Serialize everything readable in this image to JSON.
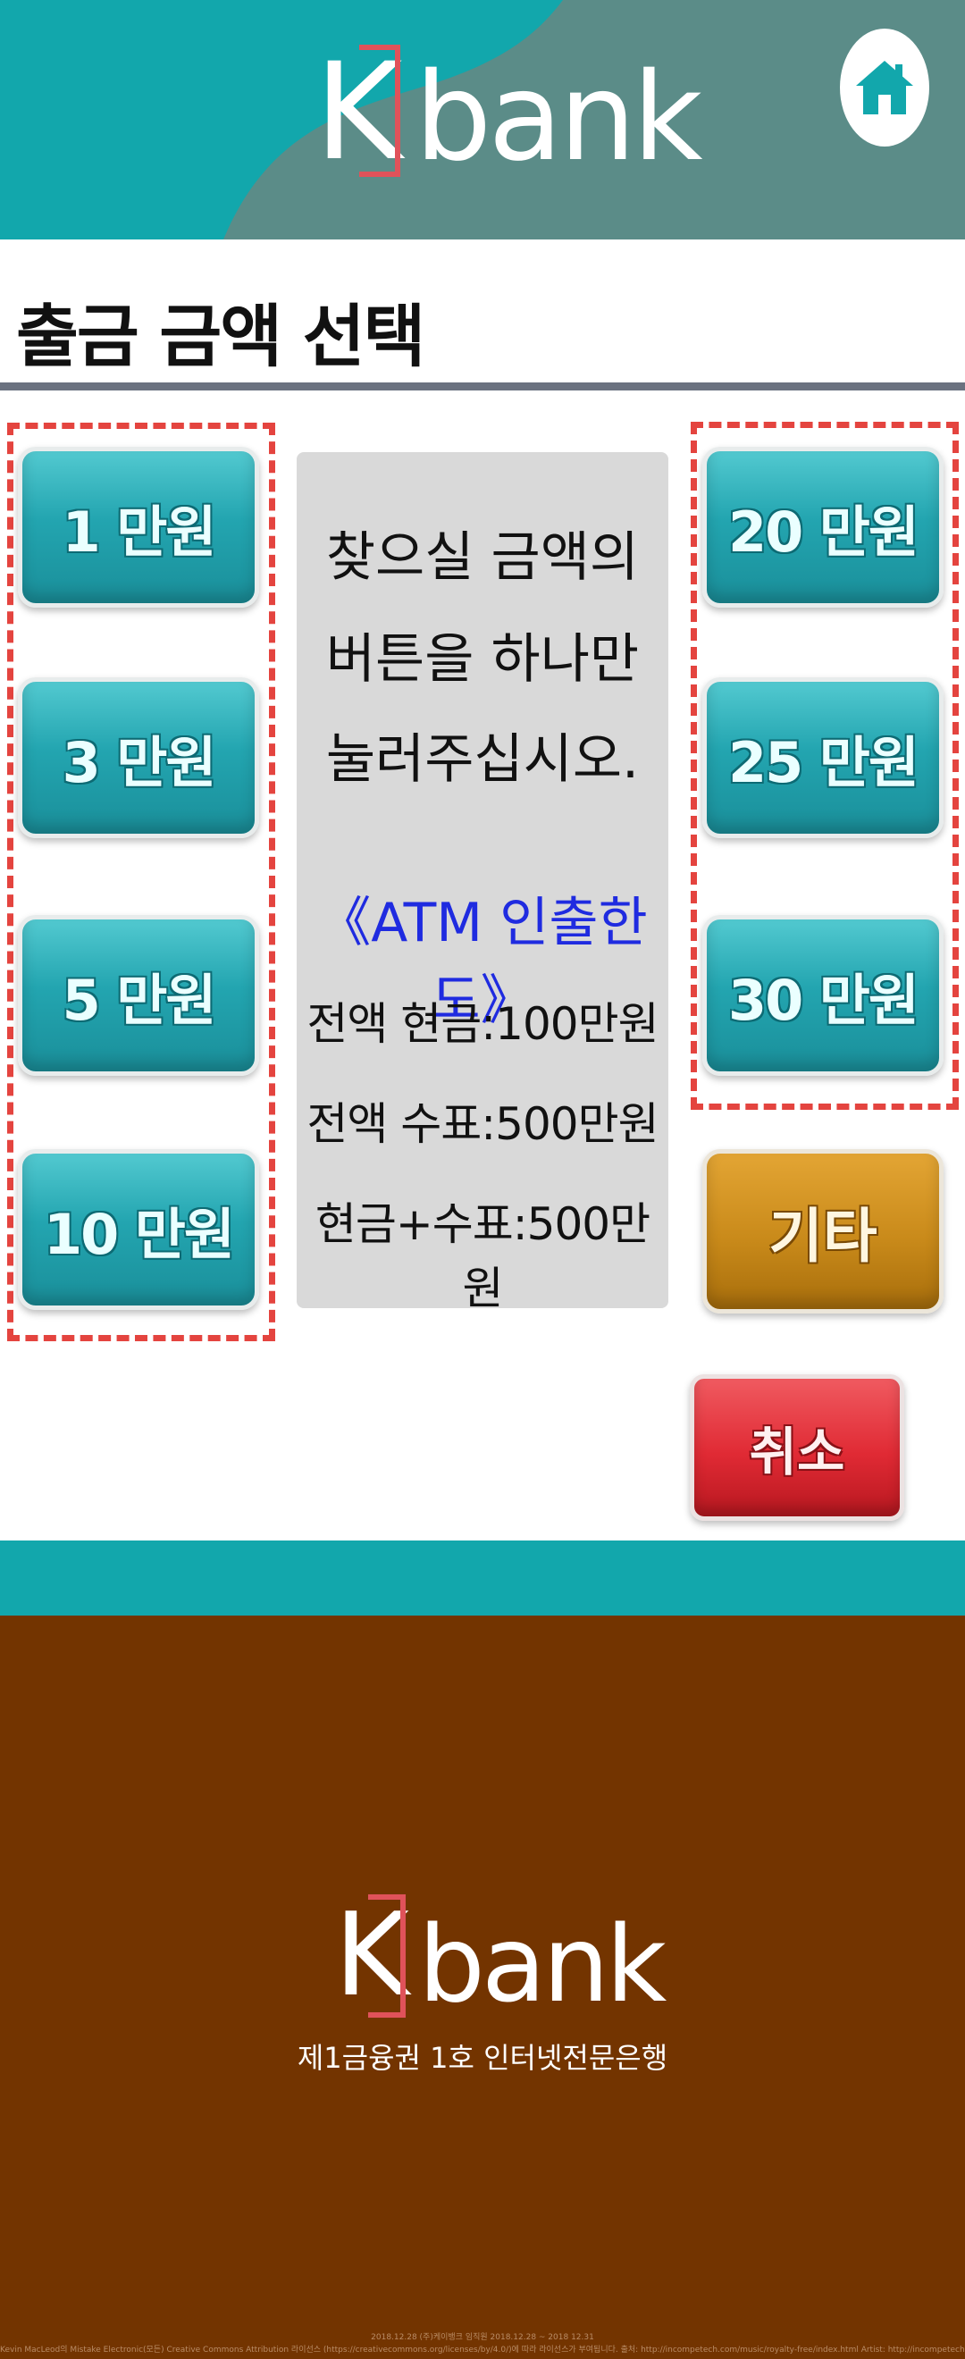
{
  "header": {
    "logo_k": "K",
    "logo_bank": "bank"
  },
  "colors": {
    "teal": "#12a7ac",
    "header_bg": "#5b8c88",
    "brand_red": "#e0525a",
    "footer_brown": "#733400",
    "limit_blue": "#1f2be0"
  },
  "title": "출금 금액 선택",
  "left_buttons": [
    "1 만원",
    "3 만원",
    "5 만원",
    "10 만원"
  ],
  "right_buttons": [
    "20 만원",
    "25 만원",
    "30 만원"
  ],
  "other_label": "기타",
  "cancel_label": "취소",
  "info": {
    "instruction_lines": [
      "찾으실 금액의",
      "버튼을 하나만",
      "눌러주십시오."
    ],
    "limit_title": "《ATM 인출한도》",
    "limits": [
      "전액 현금:100만원",
      "전액 수표:500만원",
      "현금+수표:500만원"
    ]
  },
  "footer": {
    "logo_k": "K",
    "logo_bank": "bank",
    "tagline": "제1금융권 1호 인터넷전문은행",
    "credit_line1": "2018.12.28 (주)케이뱅크 임직원 2018.12.28 ~ 2018 12.31",
    "credit_line2": "Kevin MacLeod의 Mistake Electronic(모든) Creative Commons Attribution 라이선스 (https://creativecommons.org/licenses/by/4.0/)에 따라 라이선스가 부여됩니다. 출처: http://incompetech.com/music/royalty-free/index.html Artist: http://incompetech.com/"
  },
  "icons": {
    "home": "home-icon"
  }
}
